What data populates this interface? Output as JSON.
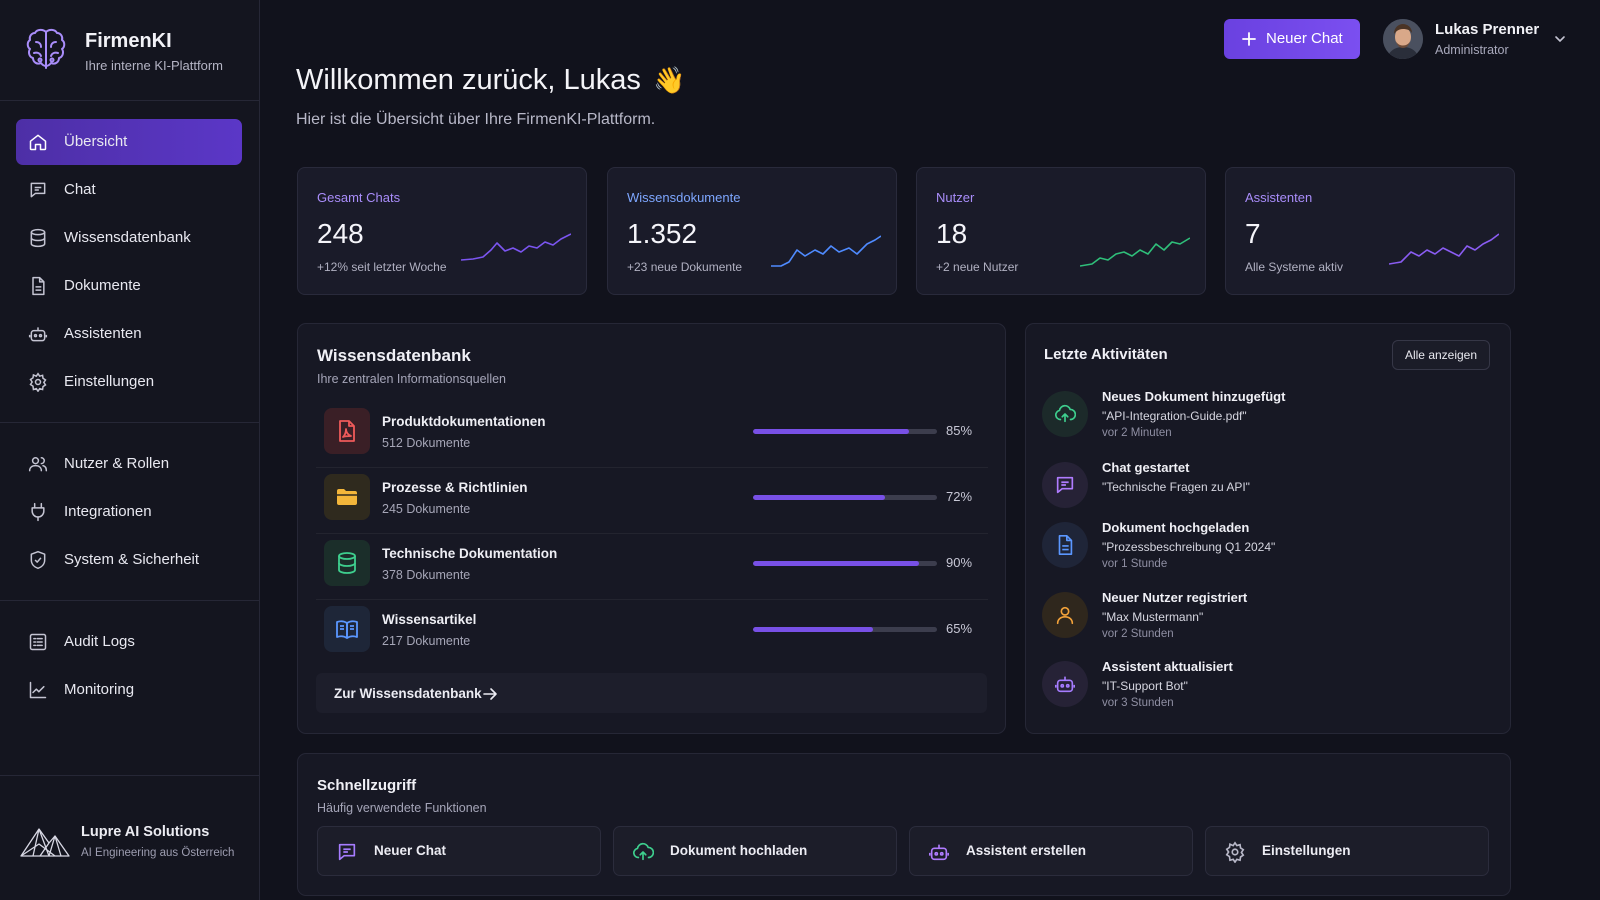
{
  "brand": {
    "name": "FirmenKI",
    "tagline": "Ihre interne KI-Plattform",
    "logo_icon": "brain-icon"
  },
  "sidebar": {
    "items": [
      {
        "label": "Übersicht",
        "icon": "home-icon",
        "active": true
      },
      {
        "label": "Chat",
        "icon": "chat-icon"
      },
      {
        "label": "Wissensdatenbank",
        "icon": "database-icon"
      },
      {
        "label": "Dokumente",
        "icon": "document-icon"
      },
      {
        "label": "Assistenten",
        "icon": "robot-icon"
      },
      {
        "label": "Einstellungen",
        "icon": "gear-icon"
      },
      {
        "label": "Nutzer & Rollen",
        "icon": "users-icon"
      },
      {
        "label": "Integrationen",
        "icon": "plug-icon"
      },
      {
        "label": "System & Sicherheit",
        "icon": "shield-icon"
      },
      {
        "label": "Audit Logs",
        "icon": "list-icon"
      },
      {
        "label": "Monitoring",
        "icon": "chart-line-icon"
      }
    ],
    "footer": {
      "name": "Lupre AI Solutions",
      "tagline": "AI Engineering aus Österreich",
      "logo_icon": "mountain-logo-icon"
    }
  },
  "header": {
    "new_chat_label": "Neuer Chat",
    "user": {
      "name": "Lukas Prenner",
      "role": "Administrator"
    }
  },
  "welcome": {
    "title": "Willkommen zurück, Lukas",
    "emoji": "👋",
    "subtitle": "Hier ist die Übersicht über Ihre FirmenKI-Plattform."
  },
  "stats": [
    {
      "label": "Gesamt Chats",
      "value": "248",
      "sub": "+12% seit letzter Woche",
      "label_color": "#a98dfa",
      "spark_color": "#7b55f0"
    },
    {
      "label": "Wissensdokumente",
      "value": "1.352",
      "sub": "+23 neue Dokumente",
      "label_color": "#7ea7ff",
      "spark_color": "#4f8bff"
    },
    {
      "label": "Nutzer",
      "value": "18",
      "sub": "+2 neue Nutzer",
      "label_color": "#a98dfa",
      "spark_color": "#2fbf7a"
    },
    {
      "label": "Assistenten",
      "value": "7",
      "sub": "Alle Systeme aktiv",
      "label_color": "#a98dfa",
      "spark_color": "#8a5cf2"
    }
  ],
  "knowledge": {
    "title": "Wissensdatenbank",
    "subtitle": "Ihre zentralen Informationsquellen",
    "items": [
      {
        "name": "Produktdokumentationen",
        "count": "512 Dokumente",
        "percent": 85,
        "percent_label": "85%",
        "icon": "pdf-icon",
        "icon_color": "#ef5a5a",
        "icon_bg": "#3a1f26"
      },
      {
        "name": "Prozesse & Richtlinien",
        "count": "245 Dokumente",
        "percent": 72,
        "percent_label": "72%",
        "icon": "folder-icon",
        "icon_color": "#f3b63a",
        "icon_bg": "#2f2a1e"
      },
      {
        "name": "Technische Dokumentation",
        "count": "378 Dokumente",
        "percent": 90,
        "percent_label": "90%",
        "icon": "database-icon",
        "icon_color": "#3ecf8e",
        "icon_bg": "#1b2e2a"
      },
      {
        "name": "Wissensartikel",
        "count": "217 Dokumente",
        "percent": 65,
        "percent_label": "65%",
        "icon": "book-icon",
        "icon_color": "#5b97ff",
        "icon_bg": "#1e2638"
      }
    ],
    "link_label": "Zur Wissensdatenbank"
  },
  "activity": {
    "title": "Letzte Aktivitäten",
    "show_all_label": "Alle anzeigen",
    "items": [
      {
        "title": "Neues Dokument hinzugefügt",
        "detail": "\"API-Integration-Guide.pdf\"",
        "time": "vor 2 Minuten",
        "icon": "cloud-upload-icon",
        "icon_color": "#3ecf8e",
        "icon_bg": "#1c2a2a"
      },
      {
        "title": "Chat gestartet",
        "detail": "\"Technische Fragen zu API\"",
        "time": "",
        "icon": "chat-icon",
        "icon_color": "#b07cff",
        "icon_bg": "#262236"
      },
      {
        "title": "Dokument hochgeladen",
        "detail": "\"Prozessbeschreibung Q1 2024\"",
        "time": "vor 1 Stunde",
        "icon": "document-icon",
        "icon_color": "#5b97ff",
        "icon_bg": "#1f2538"
      },
      {
        "title": "Neuer Nutzer registriert",
        "detail": "\"Max Mustermann\"",
        "time": "vor 2 Stunden",
        "icon": "user-icon",
        "icon_color": "#f3a23a",
        "icon_bg": "#2f271d"
      },
      {
        "title": "Assistent aktualisiert",
        "detail": "\"IT-Support Bot\"",
        "time": "vor 3 Stunden",
        "icon": "robot-icon",
        "icon_color": "#a67cff",
        "icon_bg": "#262236"
      }
    ]
  },
  "quick": {
    "title": "Schnellzugriff",
    "subtitle": "Häufig verwendete Funktionen",
    "items": [
      {
        "label": "Neuer Chat",
        "icon": "chat-icon",
        "icon_color": "#a67cff"
      },
      {
        "label": "Dokument hochladen",
        "icon": "cloud-upload-icon",
        "icon_color": "#3ecf8e"
      },
      {
        "label": "Assistent erstellen",
        "icon": "robot-icon",
        "icon_color": "#b07cff"
      },
      {
        "label": "Einstellungen",
        "icon": "gear-icon",
        "icon_color": "#b8b8c8"
      }
    ]
  }
}
